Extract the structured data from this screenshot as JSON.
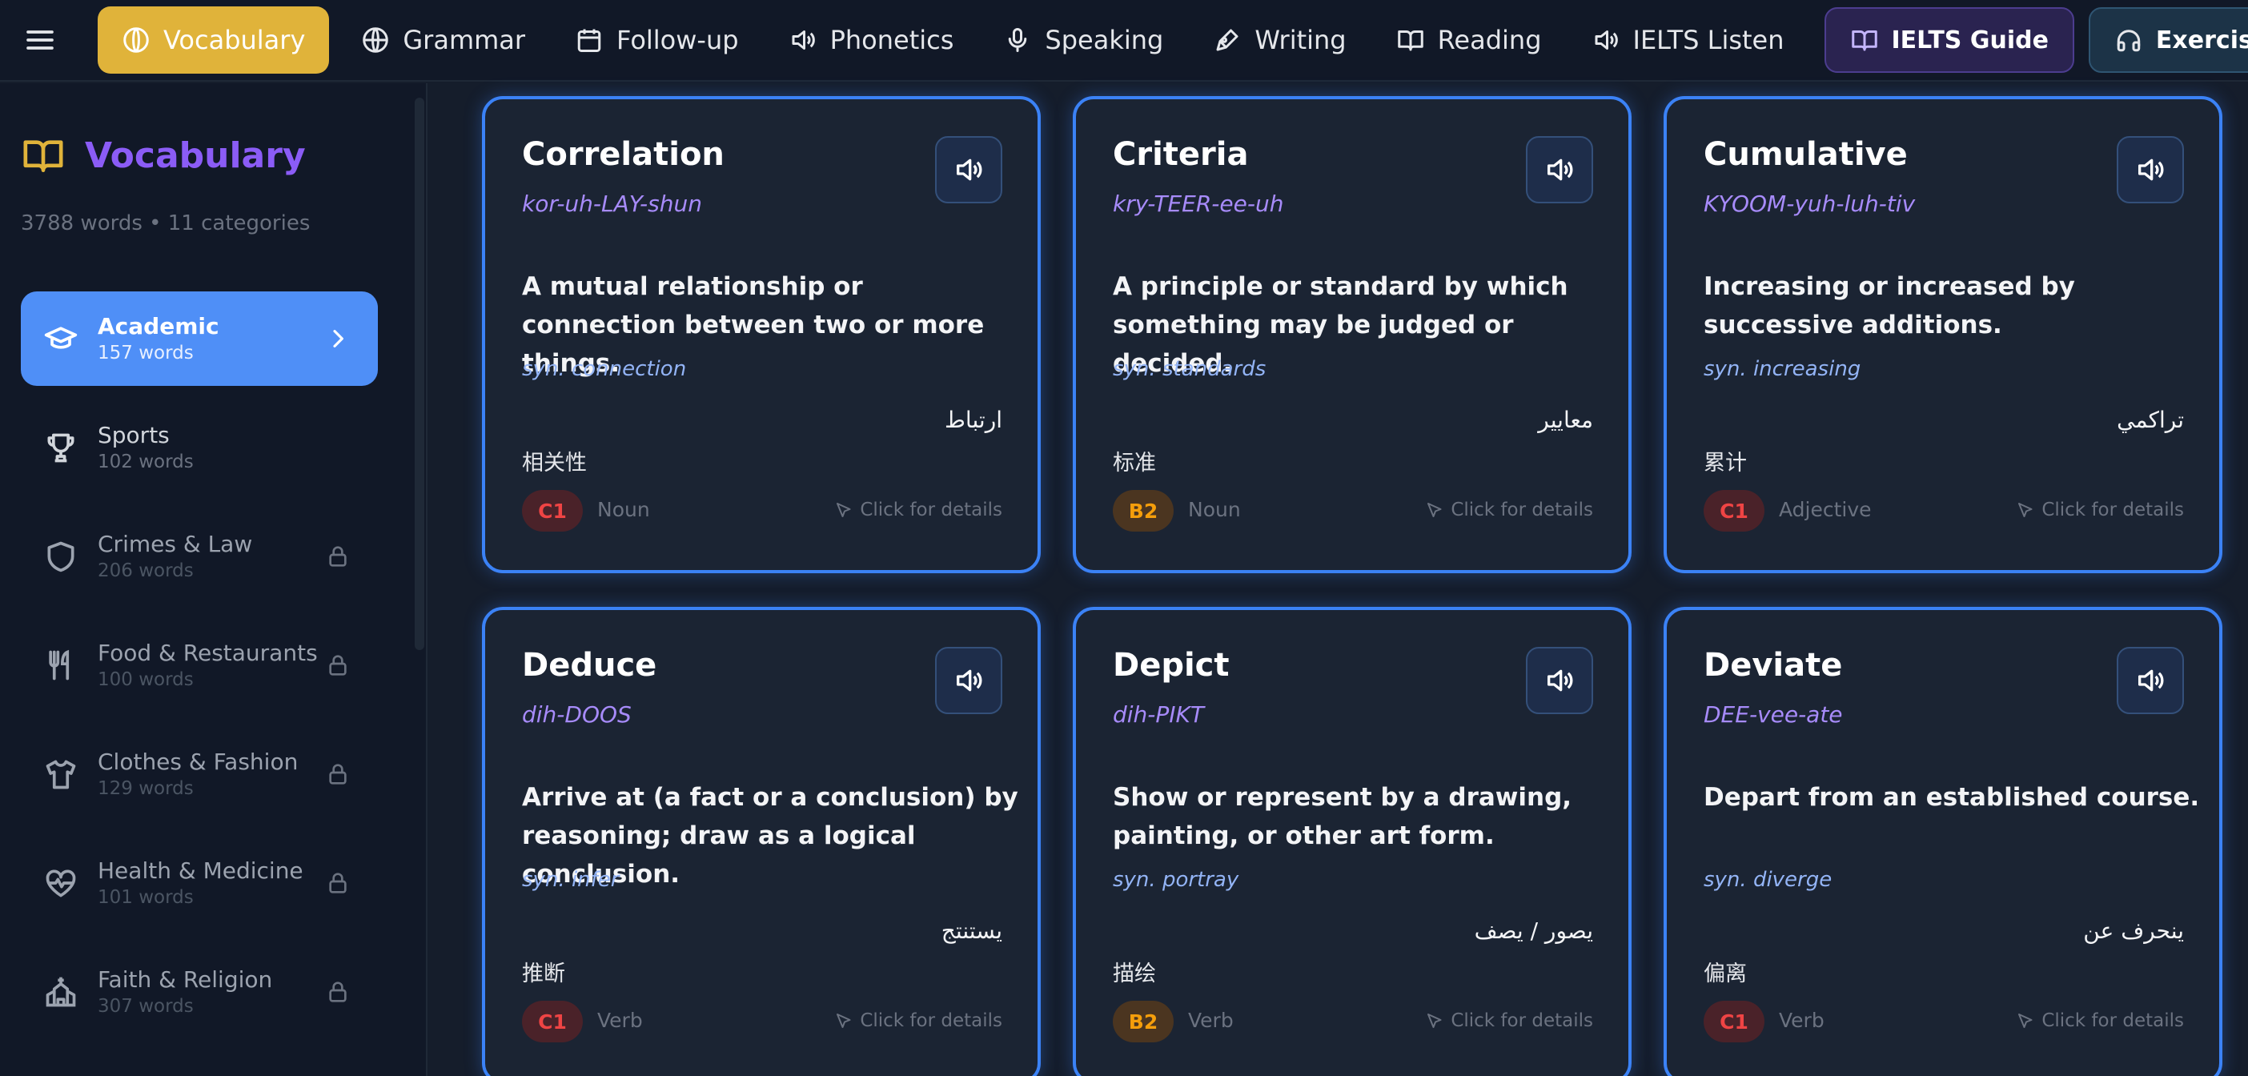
{
  "nav": {
    "items": [
      {
        "label": "Vocabulary",
        "icon": "globe-icon",
        "active": true
      },
      {
        "label": "Grammar",
        "icon": "globe-icon"
      },
      {
        "label": "Follow-up",
        "icon": "calendar-icon"
      },
      {
        "label": "Phonetics",
        "icon": "speaker-icon"
      },
      {
        "label": "Speaking",
        "icon": "microphone-icon"
      },
      {
        "label": "Writing",
        "icon": "pen-icon"
      },
      {
        "label": "Reading",
        "icon": "book-icon"
      },
      {
        "label": "IELTS Listen",
        "icon": "speaker-icon"
      }
    ],
    "guide_label": "IELTS Guide",
    "exercises_label": "Exercises"
  },
  "sidebar": {
    "title": "Vocabulary",
    "meta": "3788 words • 11 categories",
    "categories": [
      {
        "name": "Academic",
        "count": "157 words",
        "icon": "graduation-cap-icon",
        "state": "active"
      },
      {
        "name": "Sports",
        "count": "102 words",
        "icon": "trophy-icon",
        "state": "open"
      },
      {
        "name": "Crimes & Law",
        "count": "206 words",
        "icon": "shield-icon",
        "state": "locked"
      },
      {
        "name": "Food & Restaurants",
        "count": "100 words",
        "icon": "utensils-icon",
        "state": "locked"
      },
      {
        "name": "Clothes & Fashion",
        "count": "129 words",
        "icon": "shirt-icon",
        "state": "locked"
      },
      {
        "name": "Health & Medicine",
        "count": "101 words",
        "icon": "heart-pulse-icon",
        "state": "locked"
      },
      {
        "name": "Faith & Religion",
        "count": "307 words",
        "icon": "church-icon",
        "state": "locked"
      }
    ]
  },
  "cards": [
    {
      "word": "Correlation",
      "pron": "kor-uh-LAY-shun",
      "def": "A mutual relationship or connection between two or more things.",
      "syn": "syn. connection",
      "arabic": "ارتباط",
      "chinese": "相关性",
      "level": "C1",
      "pos": "Noun",
      "details": "Click for details"
    },
    {
      "word": "Criteria",
      "pron": "kry-TEER-ee-uh",
      "def": "A principle or standard by which something may be judged or decided.",
      "syn": "syn. standards",
      "arabic": "معايير",
      "chinese": "标准",
      "level": "B2",
      "pos": "Noun",
      "details": "Click for details"
    },
    {
      "word": "Cumulative",
      "pron": "KYOOM-yuh-luh-tiv",
      "def": "Increasing or increased by successive additions.",
      "syn": "syn. increasing",
      "arabic": "تراكمي",
      "chinese": "累计",
      "level": "C1",
      "pos": "Adjective",
      "details": "Click for details"
    },
    {
      "word": "Deduce",
      "pron": "dih-DOOS",
      "def": "Arrive at (a fact or a conclusion) by reasoning; draw as a logical conclusion.",
      "syn": "syn. infer",
      "arabic": "يستنتج",
      "chinese": "推断",
      "level": "C1",
      "pos": "Verb",
      "details": "Click for details"
    },
    {
      "word": "Depict",
      "pron": "dih-PIKT",
      "def": "Show or represent by a drawing, painting, or other art form.",
      "syn": "syn. portray",
      "arabic": "يصور / يصف",
      "chinese": "描绘",
      "level": "B2",
      "pos": "Verb",
      "details": "Click for details"
    },
    {
      "word": "Deviate",
      "pron": "DEE-vee-ate",
      "def": "Depart from an established course.",
      "syn": "syn. diverge",
      "arabic": "ينحرف عن",
      "chinese": "偏离",
      "level": "C1",
      "pos": "Verb",
      "details": "Click for details"
    }
  ]
}
